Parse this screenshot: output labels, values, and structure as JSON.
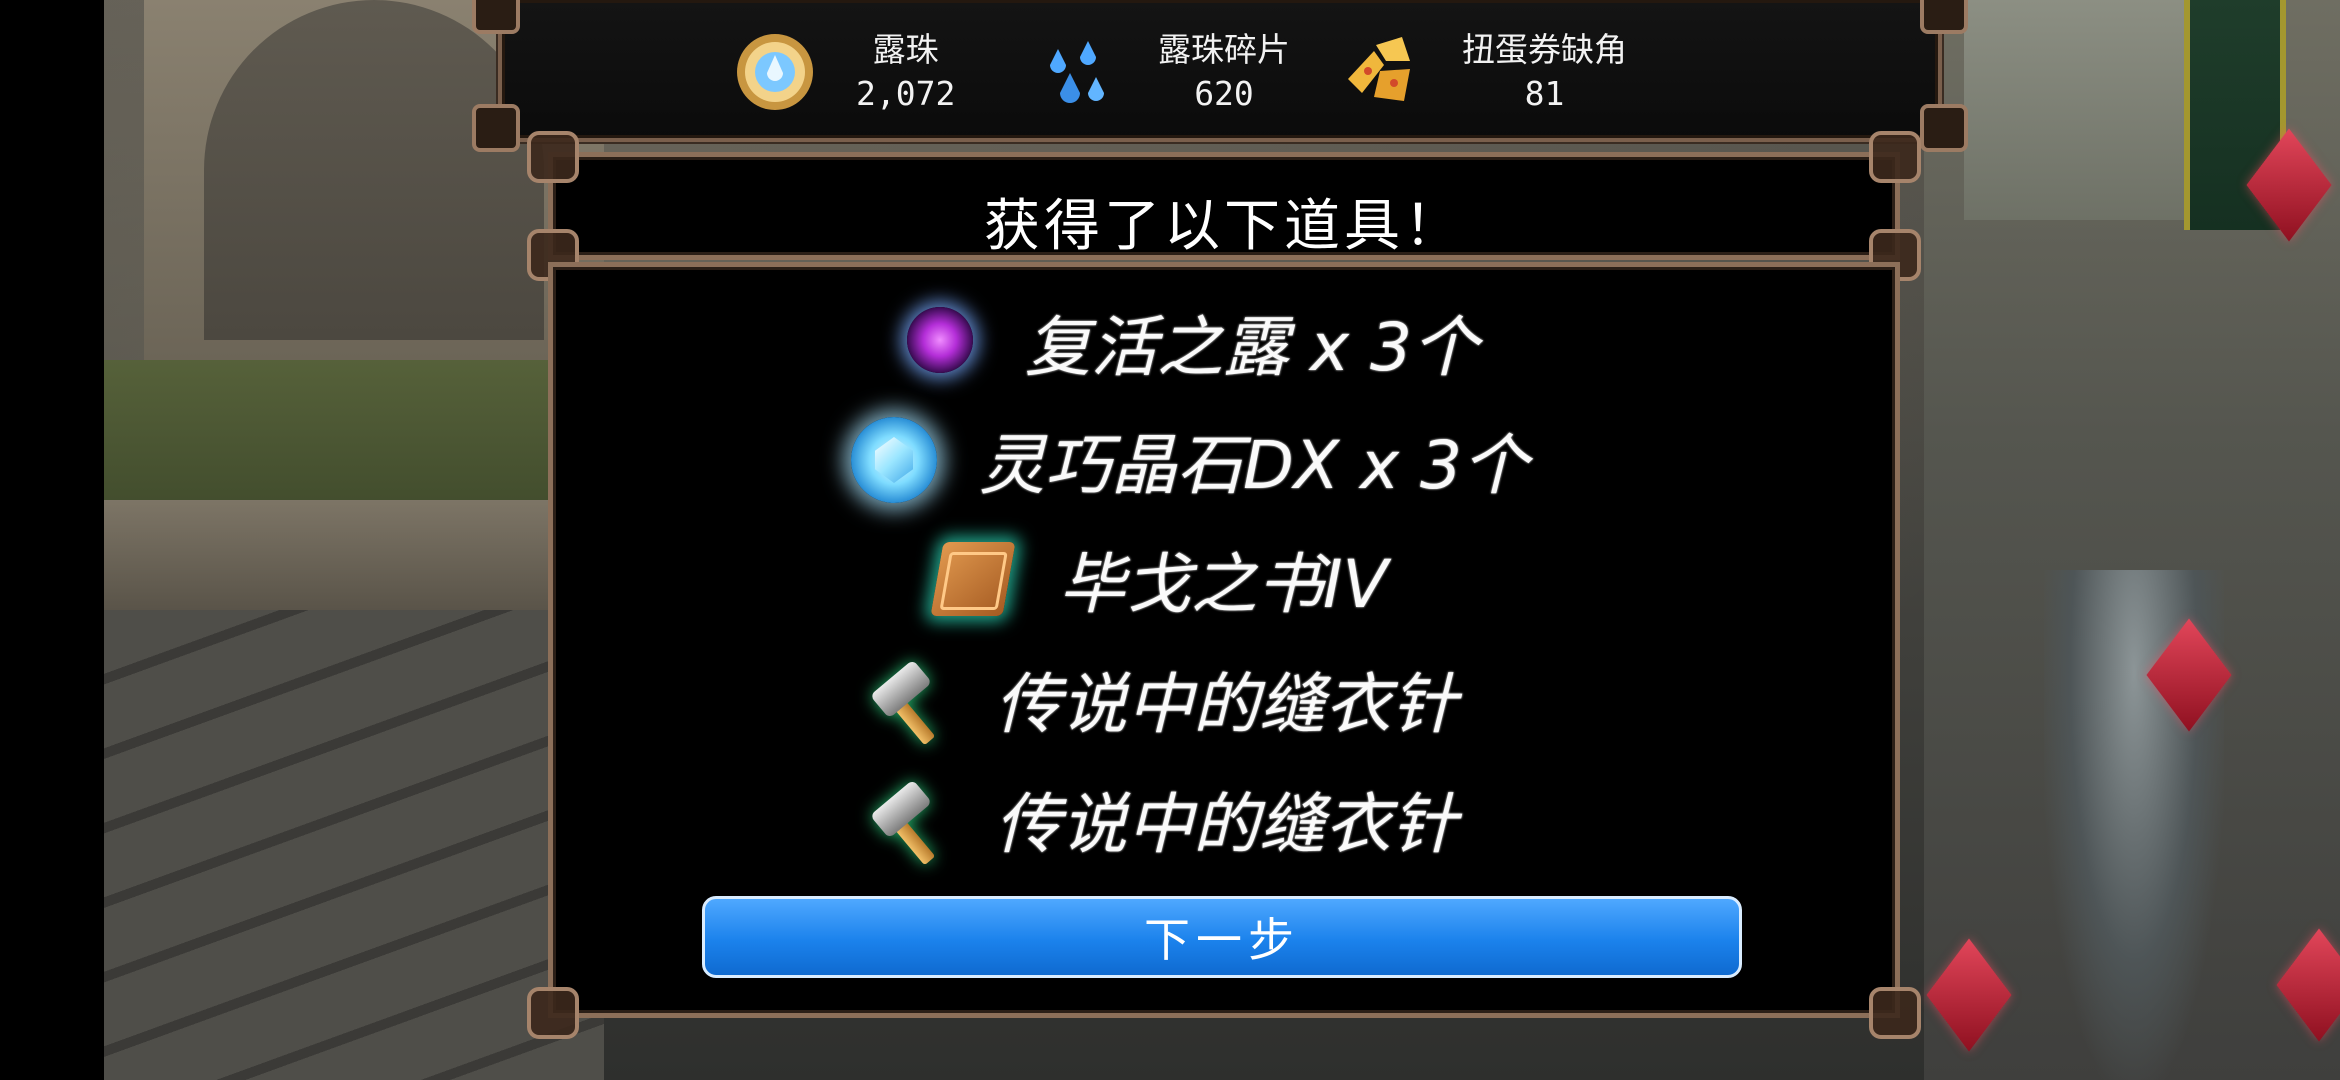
{
  "currencies": [
    {
      "label": "露珠",
      "value": "2,072",
      "icon": "dew-pearl-icon"
    },
    {
      "label": "露珠碎片",
      "value": "620",
      "icon": "dew-fragment-icon"
    },
    {
      "label": "扭蛋券缺角",
      "value": "81",
      "icon": "gacha-ticket-fragment-icon"
    }
  ],
  "dialog": {
    "title": "获得了以下道具！",
    "items": [
      {
        "name": "复活之露 x 3个",
        "icon": "purple-orb-icon"
      },
      {
        "name": "灵巧晶石DX x 3个",
        "icon": "blue-gem-icon"
      },
      {
        "name": "毕戈之书IV",
        "icon": "book-icon"
      },
      {
        "name": "传说中的缝衣针",
        "icon": "hammer-icon"
      },
      {
        "name": "传说中的缝衣针",
        "icon": "hammer-icon"
      }
    ],
    "next_label": "下一步"
  },
  "colors": {
    "frame": "#8c6f59",
    "button": "#1b82ec",
    "text": "#ffffff"
  }
}
